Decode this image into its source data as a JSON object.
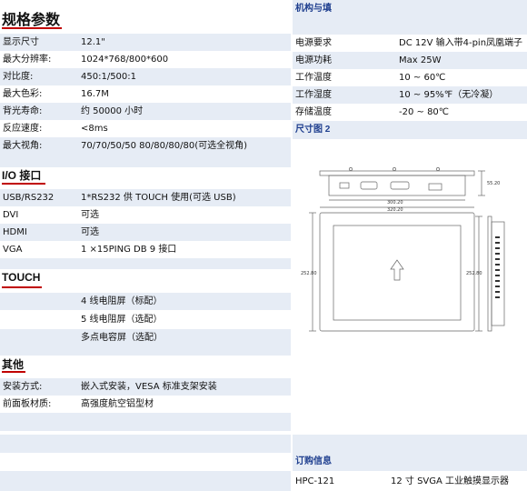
{
  "spec": {
    "title": "规格参数",
    "rows": [
      {
        "k": "显示尺寸",
        "v": "12.1\""
      },
      {
        "k": "最大分辨率:",
        "v": "1024*768/800*600"
      },
      {
        "k": "对比度:",
        "v": "450:1/500:1"
      },
      {
        "k": "最大色彩:",
        "v": "16.7M"
      },
      {
        "k": "背光寿命:",
        "v": "约 50000 小时"
      },
      {
        "k": "反应速度:",
        "v": "<8ms"
      },
      {
        "k": "最大视角:",
        "v": "70/70/50/50    80/80/80/80(可选全视角)"
      }
    ]
  },
  "io": {
    "title": "I/O 接口",
    "rows": [
      {
        "k": "USB/RS232",
        "v": "1*RS232 供 TOUCH 使用(可选 USB)"
      },
      {
        "k": "DVI",
        "v": "可选"
      },
      {
        "k": "HDMI",
        "v": "可选"
      },
      {
        "k": "VGA",
        "v": " 1 ×15PING DB 9 接口"
      }
    ]
  },
  "touch": {
    "title": "TOUCH",
    "rows": [
      {
        "k": "",
        "v": "4 线电阻屏（标配）"
      },
      {
        "k": "",
        "v": "5 线电阻屏（选配）"
      },
      {
        "k": "",
        "v": "多点电容屏（选配）"
      }
    ]
  },
  "other": {
    "title": "其他",
    "rows": [
      {
        "k": "安装方式:",
        "v": "嵌入式安装，VESA 标准支架安装"
      },
      {
        "k": "前面板材质:",
        "v": "高强度航空铝型材"
      }
    ]
  },
  "mech": {
    "title": "机构与填",
    "rows": [
      {
        "k": "电源要求",
        "v": "DC 12V 输入带4-pin凤凰端子"
      },
      {
        "k": "电源功耗",
        "v": "Max   25W"
      },
      {
        "k": "工作温度",
        "v": "10 ~ 60℃"
      },
      {
        "k": "工作湿度",
        "v": "10 ~ 95%℉（无冷凝）"
      },
      {
        "k": "存储温度",
        "v": "-20 ~ 80℃"
      }
    ]
  },
  "dims": {
    "title": "尺寸图 2",
    "labels": {
      "top_height": "55.20",
      "inner_width": "300.20",
      "outer_width": "320.20",
      "front_height": "252.80",
      "side_height": "252.80"
    }
  },
  "order": {
    "title": "订购信息",
    "model": "HPC-121",
    "desc": "12 寸  SVGA  工业触摸显示器"
  },
  "colors": {
    "shade": "#e6ecf5",
    "accent": "#c00000",
    "header_text": "#1f3f8f"
  }
}
